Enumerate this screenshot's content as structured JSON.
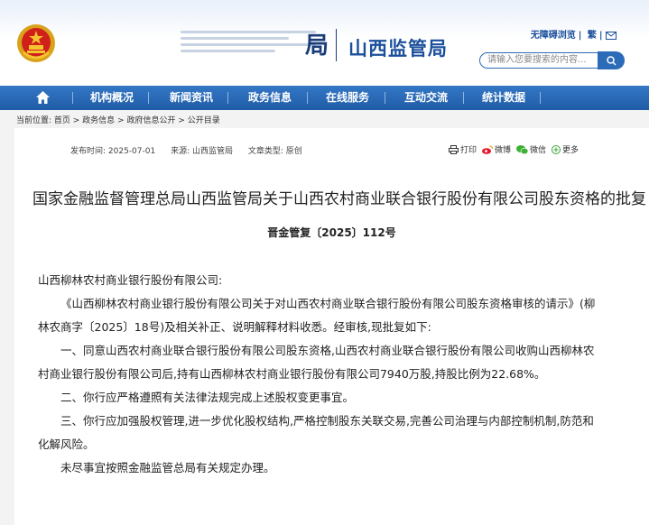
{
  "header": {
    "site_title": "山西监管局",
    "ghost_char": "局",
    "toplinks": [
      "无障碍浏览",
      "繁"
    ],
    "search_placeholder": "请输入您要搜索的内容...",
    "accent": "#1b4f9c"
  },
  "nav": {
    "items": [
      "机构概况",
      "新闻资讯",
      "政务信息",
      "在线服务",
      "互动交流",
      "统计数据"
    ]
  },
  "breadcrumb": {
    "label": "当前位置:",
    "path": "首页 > 政务信息 > 政府信息公开 > 公开目录"
  },
  "meta": {
    "date": "发布时间: 2025-07-01",
    "source": "来源: 山西监管局",
    "type": "文章类型: 原创"
  },
  "share": {
    "print": "打印",
    "weibo": "微博",
    "wechat": "微信",
    "more": "更多"
  },
  "article": {
    "title": "国家金融监督管理总局山西监管局关于山西农村商业联合银行股份有限公司股东资格的批复",
    "doc_number": "晋金管复〔2025〕112号",
    "addressee": "山西柳林农村商业银行股份有限公司:",
    "para1": "《山西柳林农村商业银行股份有限公司关于对山西农村商业联合银行股份有限公司股东资格审核的请示》(柳林农商字〔2025〕18号)及相关补正、说明解释材料收悉。经审核,现批复如下:",
    "para2": "一、同意山西农村商业联合银行股份有限公司股东资格,山西农村商业联合银行股份有限公司收购山西柳林农村商业银行股份有限公司后,持有山西柳林农村商业银行股份有限公司7940万股,持股比例为22.68%。",
    "para3": "二、你行应严格遵照有关法律法规完成上述股权变更事宜。",
    "para4": "三、你行应加强股权管理,进一步优化股权结构,严格控制股东关联交易,完善公司治理与内部控制机制,防范和化解风险。",
    "para5": "未尽事宜按照金融监管总局有关规定办理。"
  }
}
